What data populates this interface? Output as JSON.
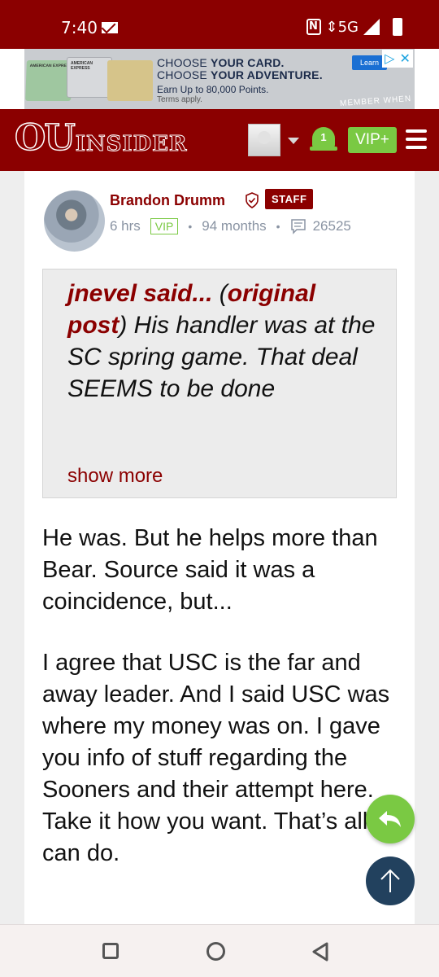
{
  "status_bar": {
    "time": "7:40",
    "network": "5G",
    "icons": [
      "mail-icon",
      "nfc-icon",
      "signal-icon",
      "battery-icon"
    ]
  },
  "ad": {
    "card_label": "AMERICAN EXPRESS",
    "line1_prefix": "CHOOSE ",
    "line1_bold": "YOUR CARD.",
    "line2_prefix": "CHOOSE ",
    "line2_bold": "YOUR ADVENTURE.",
    "line3": "Earn Up to 80,000 Points.",
    "line4": "Terms apply.",
    "learn": "Learn",
    "member": "MEMBER WHEN"
  },
  "header": {
    "logo_primary": "OU",
    "logo_secondary": "INSIDER",
    "notification_count": "1",
    "vip_label": "VIP+"
  },
  "post": {
    "author": "Brandon Drumm",
    "badge": "STAFF",
    "time": "6 hrs",
    "vip_tag": "VIP",
    "membership": "94 months",
    "comment_count": "26525",
    "quote": {
      "user": "jnevel said...",
      "original_link": "original post",
      "text": "His handler was at the SC spring game. That deal SEEMS to be done",
      "show_more": "show more"
    },
    "paragraph1": "He was. But he helps more than Bear. Source said it was a coincidence, but...",
    "paragraph2": "I agree that USC is the far and away leader. And I said USC was where my money was on. I gave you info of stuff regarding the Sooners and their attempt here. Take it how you want. That’s all I can do."
  },
  "colors": {
    "brand": "#8b0000",
    "accent_green": "#7ac943",
    "fab_dark": "#22415e"
  }
}
